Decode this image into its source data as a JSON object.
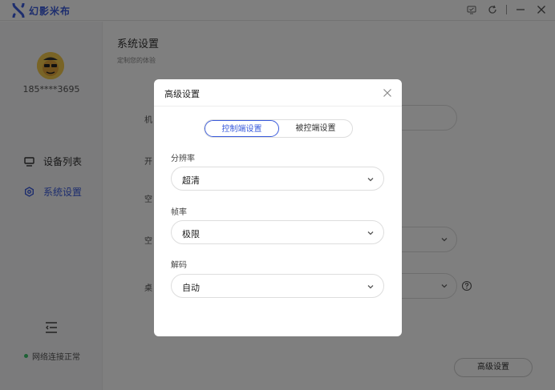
{
  "app": {
    "name": "幻影米布"
  },
  "window_controls": [
    "screen-icon",
    "refresh-icon",
    "minimize-icon",
    "close-icon"
  ],
  "sidebar": {
    "phone": "185****3695",
    "items": [
      {
        "label": "设备列表",
        "icon": "monitor-icon",
        "active": false
      },
      {
        "label": "系统设置",
        "icon": "gear-icon",
        "active": true
      }
    ],
    "network_status": "网络连接正常"
  },
  "main": {
    "title": "系统设置",
    "subtitle": "定制您的体验",
    "row_labels": [
      "机",
      "开",
      "空",
      "空",
      "桌"
    ],
    "advanced_button": "高级设置"
  },
  "modal": {
    "title": "高级设置",
    "tabs": [
      {
        "label": "控制端设置",
        "active": true
      },
      {
        "label": "被控端设置",
        "active": false
      }
    ],
    "fields": [
      {
        "label": "分辨率",
        "value": "超清"
      },
      {
        "label": "帧率",
        "value": "极限"
      },
      {
        "label": "解码",
        "value": "自动"
      }
    ]
  },
  "colors": {
    "accent": "#3a5bdc",
    "overlay": "rgba(0,0,0,0.5)",
    "status_ok": "#3cc36b"
  }
}
